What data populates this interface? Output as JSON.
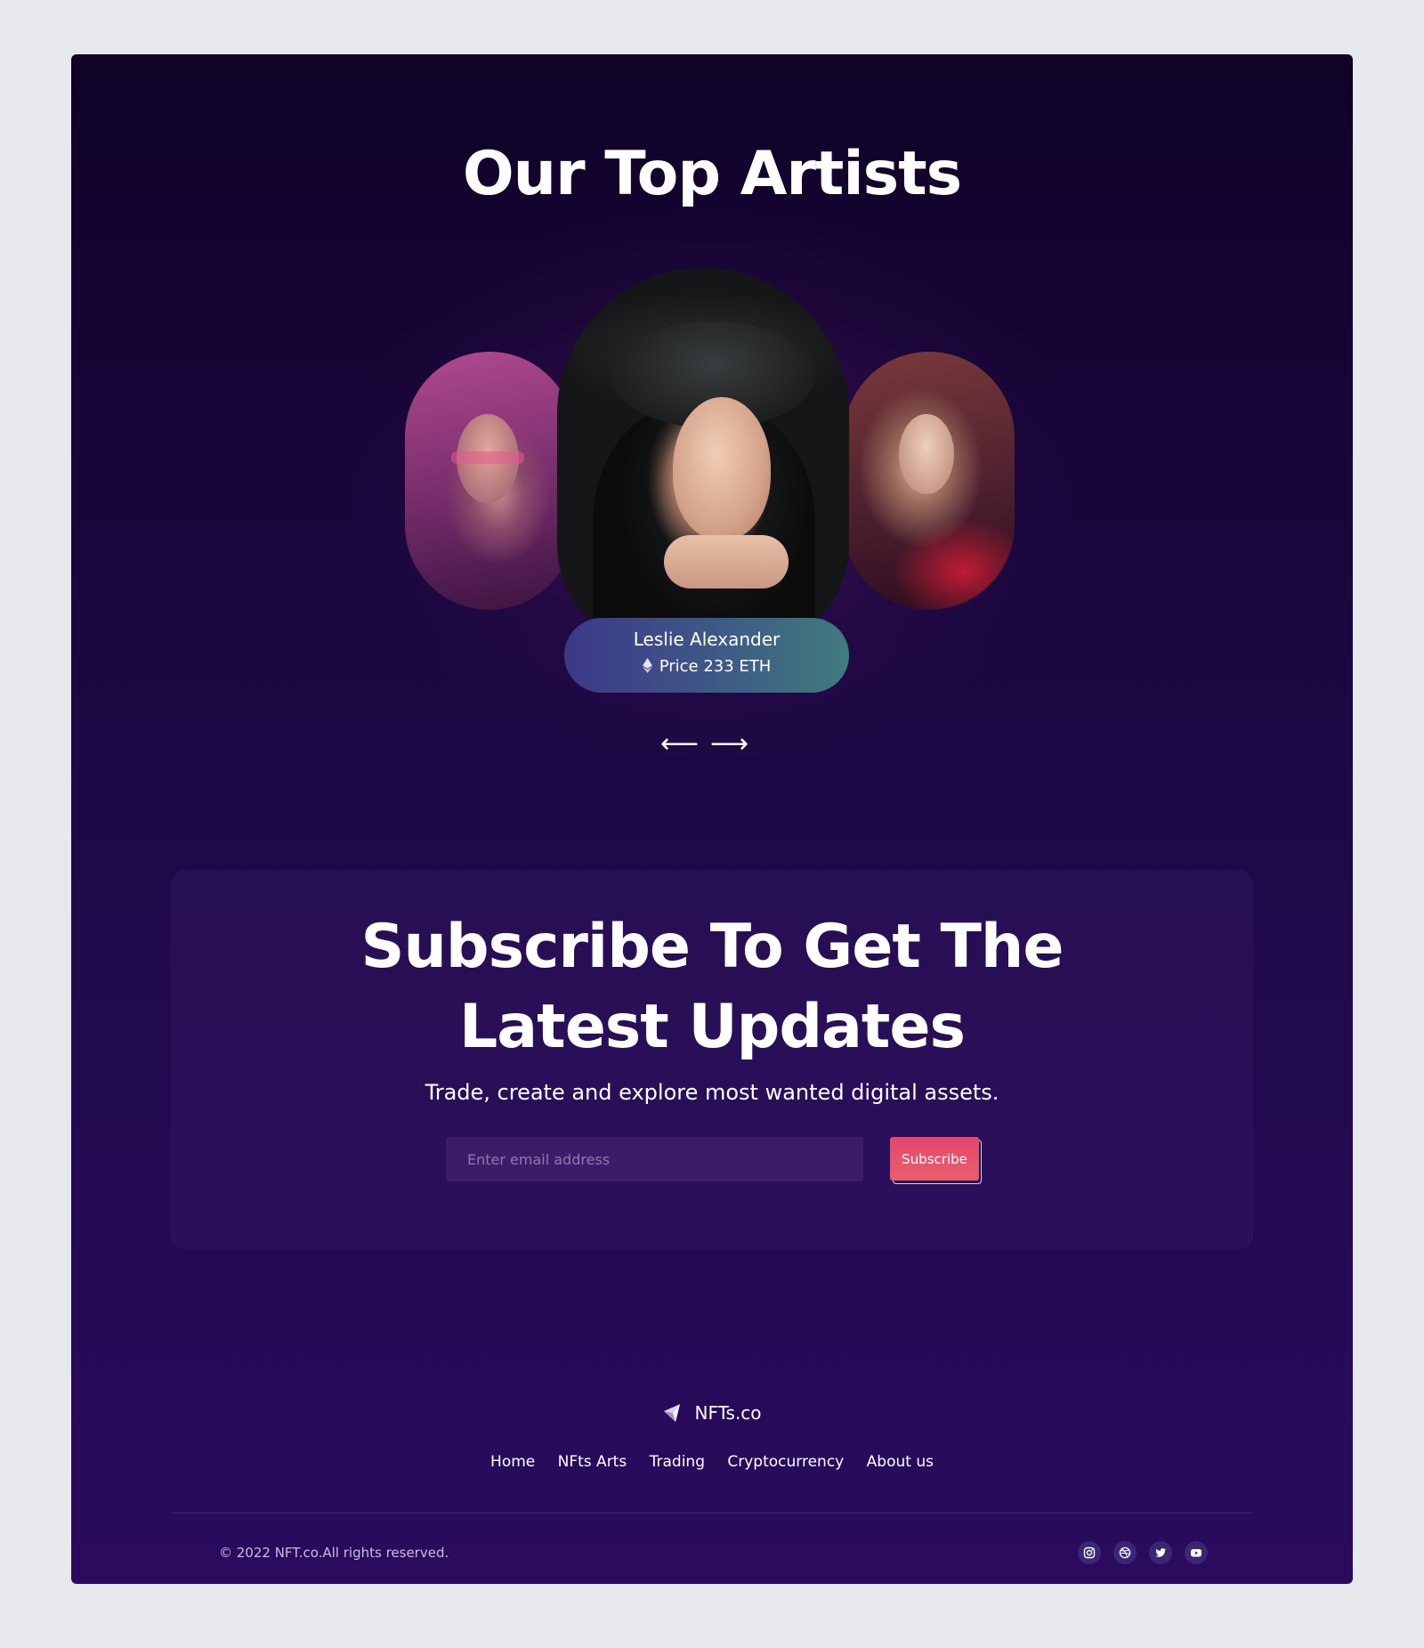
{
  "section_artists": {
    "title": "Our Top Artists",
    "featured": {
      "name": "Leslie Alexander",
      "price": "Price 233 ETH"
    },
    "prev_icon": "⟵",
    "next_icon": "⟶"
  },
  "subscribe": {
    "title_line1": "Subscribe To Get The",
    "title_line2": "Latest Updates",
    "description": "Trade, create and explore most wanted digital assets.",
    "email_placeholder": "Enter email address",
    "button_label": "Subscribe"
  },
  "footer": {
    "brand": "NFTs.co",
    "nav": [
      "Home",
      "NFts Arts",
      "Trading",
      "Cryptocurrency",
      "About us"
    ],
    "copyright": "© 2022 NFT.co.All rights reserved.",
    "social_icons": [
      "instagram-icon",
      "dribbble-icon",
      "twitter-icon",
      "youtube-icon"
    ]
  },
  "colors": {
    "accent": "#e4476c",
    "background": "#1f0a4a",
    "nameplate_start": "#3d3888",
    "nameplate_end": "#3f7c7c"
  }
}
